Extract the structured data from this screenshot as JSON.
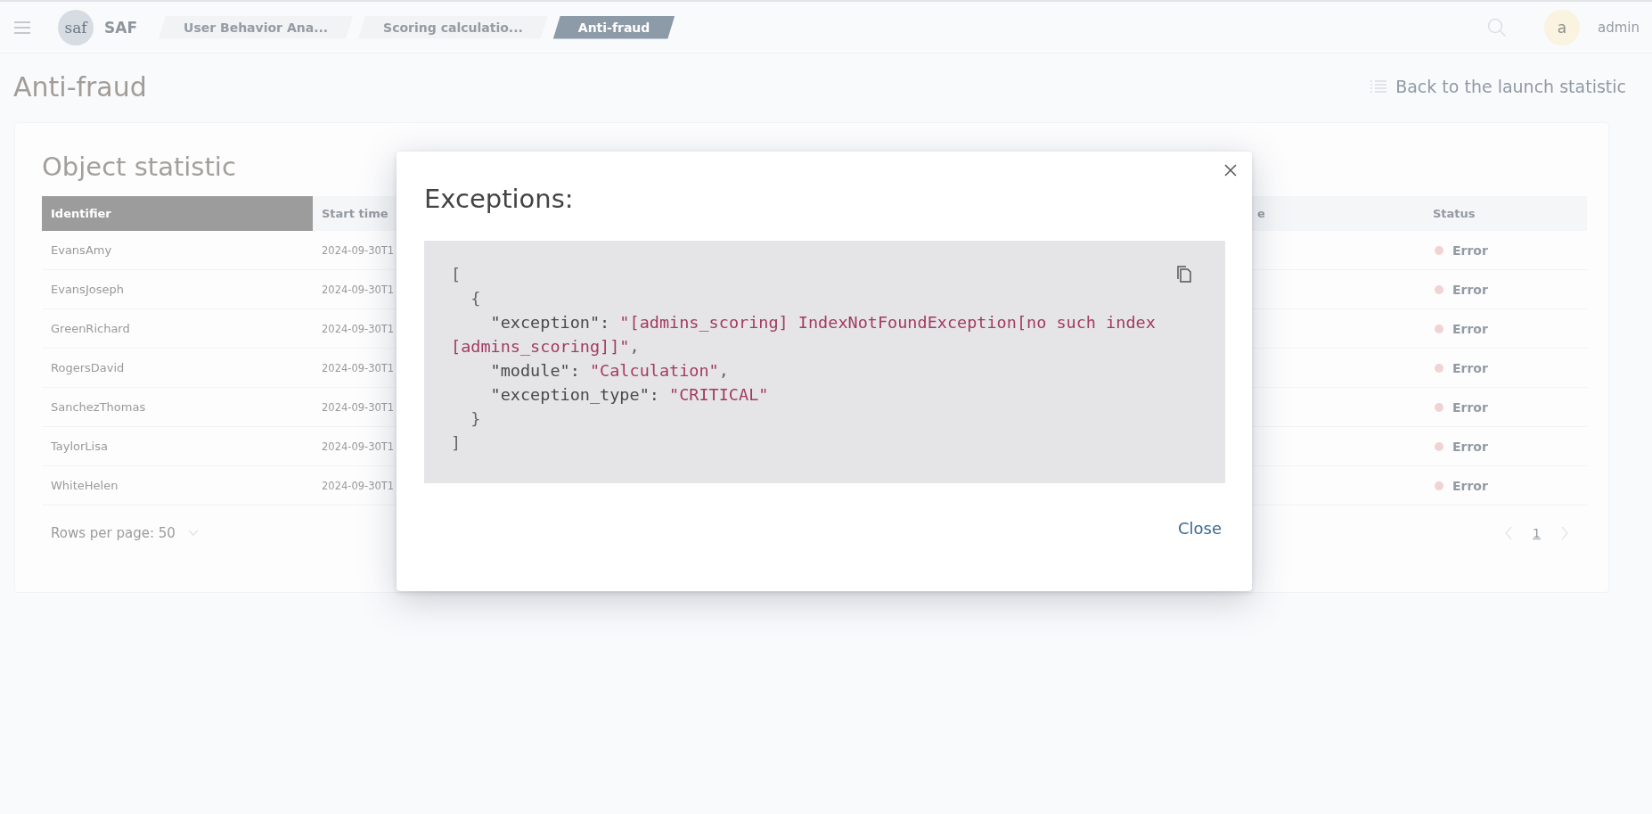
{
  "app": {
    "name": "SAF",
    "logo_text": "saf"
  },
  "breadcrumbs": [
    {
      "label": "User Behavior Ana...",
      "selected": false
    },
    {
      "label": "Scoring calculatio...",
      "selected": false
    },
    {
      "label": "Anti-fraud",
      "selected": true
    }
  ],
  "user": {
    "initial": "a",
    "name": "admin"
  },
  "page": {
    "title": "Anti-fraud",
    "back_link": "Back to the launch statistic"
  },
  "card": {
    "title": "Object statistic",
    "columns": [
      {
        "label": "Identifier",
        "selected": true
      },
      {
        "label": "Start time",
        "selected": false
      },
      {
        "label": "e",
        "selected": false
      },
      {
        "label": "Status",
        "selected": false
      }
    ],
    "rows": [
      {
        "identifier": "EvansAmy",
        "start_time": "2024-09-30T1",
        "status": "Error",
        "color": "#f2d3d3"
      },
      {
        "identifier": "EvansJoseph",
        "start_time": "2024-09-30T1",
        "status": "Error",
        "color": "#f2d3d3"
      },
      {
        "identifier": "GreenRichard",
        "start_time": "2024-09-30T1",
        "status": "Error",
        "color": "#f2d3d3"
      },
      {
        "identifier": "RogersDavid",
        "start_time": "2024-09-30T1",
        "status": "Error",
        "color": "#f2d3d3"
      },
      {
        "identifier": "SanchezThomas",
        "start_time": "2024-09-30T1",
        "status": "Error",
        "color": "#f2d3d3"
      },
      {
        "identifier": "TaylorLisa",
        "start_time": "2024-09-30T1",
        "status": "Error",
        "color": "#f2d3d3"
      },
      {
        "identifier": "WhiteHelen",
        "start_time": "2024-09-30T1",
        "status": "Error",
        "color": "#f2d3d3"
      }
    ],
    "rows_per_page": "Rows per page: 50",
    "pages": [
      {
        "label": "1",
        "selected": true
      }
    ]
  },
  "dialog": {
    "title": "Exceptions:",
    "close_button": "Close",
    "code": [
      {
        "kind": "punct",
        "text": "[\n  {\n    "
      },
      {
        "kind": "key",
        "text": "\"exception\": "
      },
      {
        "kind": "string",
        "text": "\"[admins_scoring] IndexNotFoundException[no such index [admins_scoring]]\""
      },
      {
        "kind": "punct",
        "text": ",\n    "
      },
      {
        "kind": "key",
        "text": "\"module\": "
      },
      {
        "kind": "string",
        "text": "\"Calculation\""
      },
      {
        "kind": "punct",
        "text": ",\n    "
      },
      {
        "kind": "key",
        "text": "\"exception_type\": "
      },
      {
        "kind": "string",
        "text": "\"CRITICAL\""
      },
      {
        "kind": "punct",
        "text": "\n  }\n]"
      }
    ]
  }
}
